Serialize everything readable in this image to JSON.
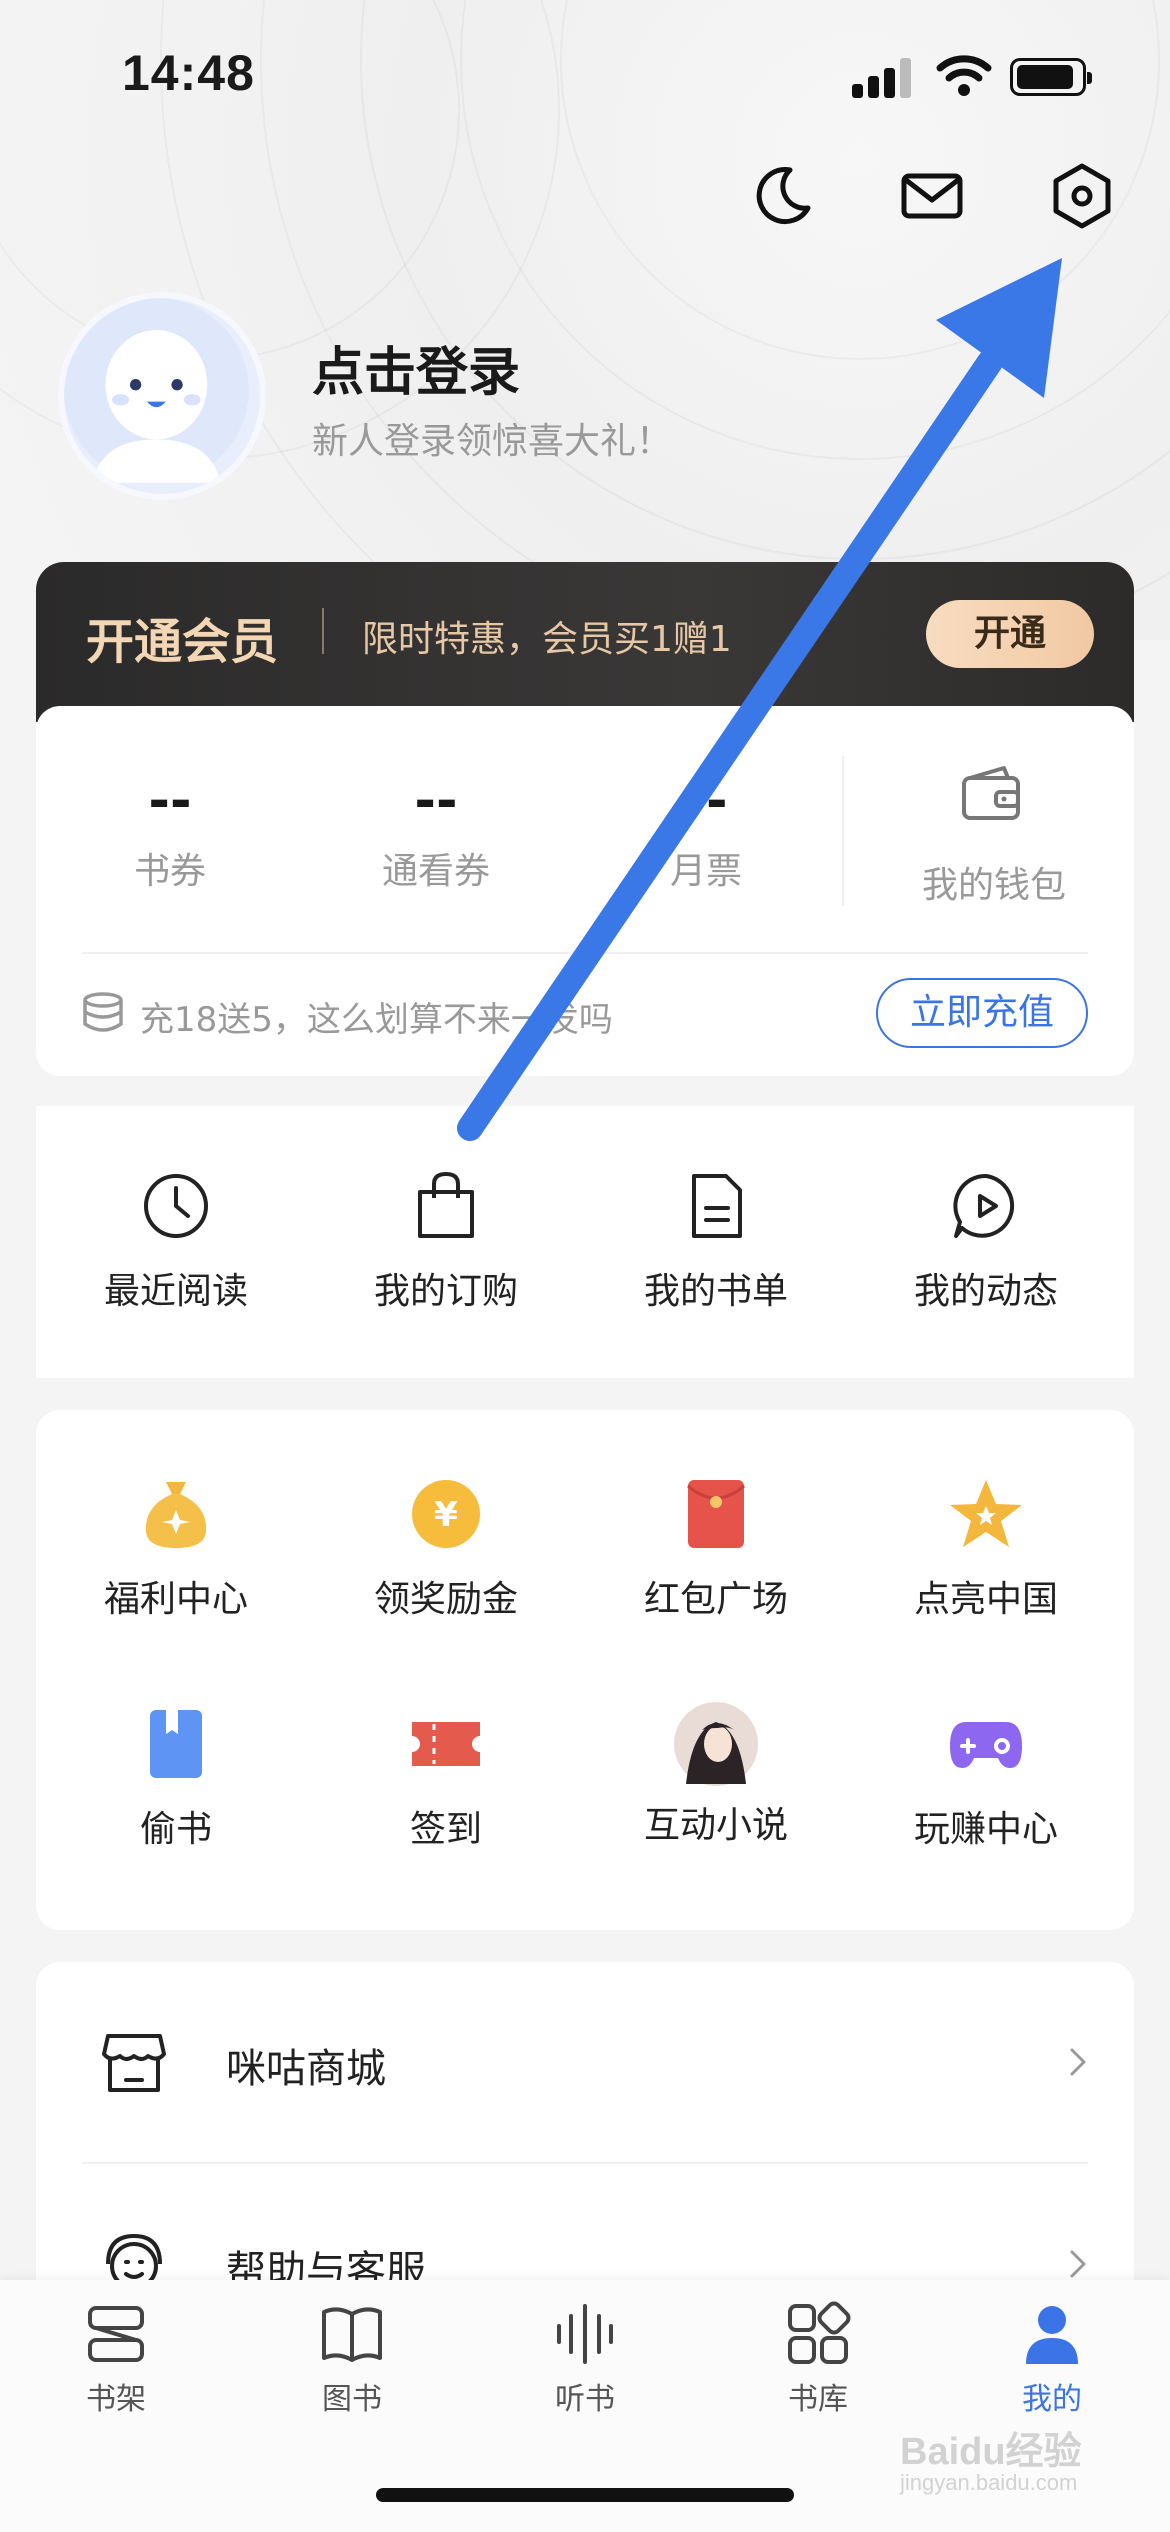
{
  "status_bar": {
    "time": "14:48"
  },
  "profile": {
    "login_title": "点击登录",
    "login_subtitle": "新人登录领惊喜大礼！"
  },
  "vip": {
    "title": "开通会员",
    "promo": "限时特惠，会员买1赠1",
    "button": "开通"
  },
  "wallet": {
    "stats": [
      {
        "value": "--",
        "label": "书券"
      },
      {
        "value": "--",
        "label": "通看券"
      },
      {
        "value": "--",
        "label": "月票"
      }
    ],
    "wallet_label": "我的钱包",
    "promo_text": "充18送5，这么划算不来一发吗",
    "recharge_button": "立即充值"
  },
  "quick_links": [
    {
      "label": "最近阅读",
      "icon": "clock-icon"
    },
    {
      "label": "我的订购",
      "icon": "shopping-bag-icon"
    },
    {
      "label": "我的书单",
      "icon": "document-icon"
    },
    {
      "label": "我的动态",
      "icon": "play-bubble-icon"
    }
  ],
  "welfare": [
    {
      "label": "福利中心",
      "icon": "money-bag-icon"
    },
    {
      "label": "领奖励金",
      "icon": "yuan-coin-icon"
    },
    {
      "label": "红包广场",
      "icon": "red-envelope-icon"
    },
    {
      "label": "点亮中国",
      "icon": "star-icon"
    },
    {
      "label": "偷书",
      "icon": "book-icon"
    },
    {
      "label": "签到",
      "icon": "ticket-icon"
    },
    {
      "label": "互动小说",
      "icon": "character-avatar-icon"
    },
    {
      "label": "玩赚中心",
      "icon": "gamepad-icon"
    }
  ],
  "list": [
    {
      "label": "咪咕商城",
      "icon": "store-icon"
    },
    {
      "label": "帮助与客服",
      "icon": "customer-service-icon"
    }
  ],
  "tabs": [
    {
      "label": "书架",
      "icon": "bookshelf-icon"
    },
    {
      "label": "图书",
      "icon": "open-book-icon"
    },
    {
      "label": "听书",
      "icon": "audio-wave-icon"
    },
    {
      "label": "书库",
      "icon": "grid-icon"
    },
    {
      "label": "我的",
      "icon": "person-icon",
      "active": true
    }
  ],
  "colors": {
    "accent": "#3a74e6",
    "annotation_arrow": "#3b78e7"
  },
  "watermark": {
    "brand": "Baidu经验",
    "url": "jingyan.baidu.com"
  }
}
